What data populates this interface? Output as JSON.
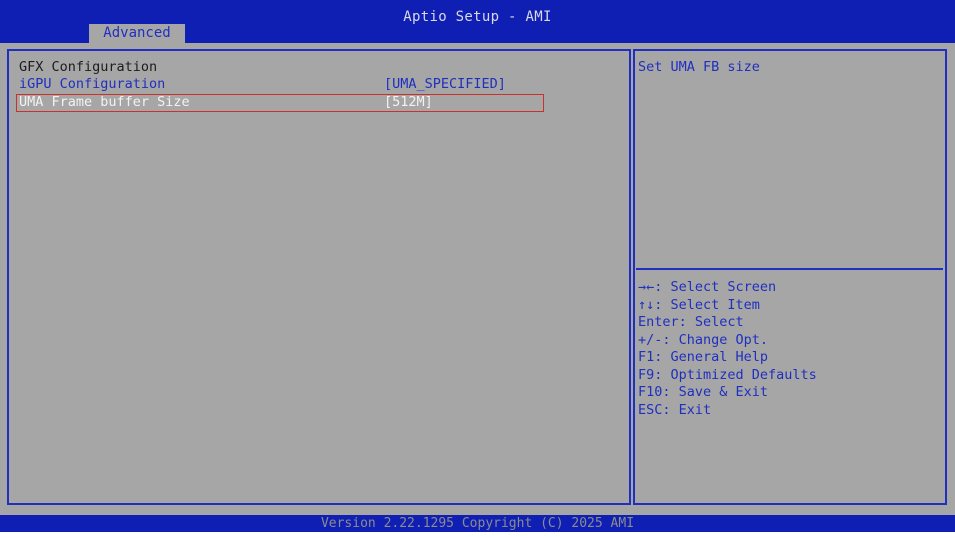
{
  "header": {
    "title": "Aptio Setup - AMI",
    "active_tab": "Advanced"
  },
  "main": {
    "section_title": "GFX Configuration",
    "items": [
      {
        "label": "iGPU Configuration",
        "value": "[UMA_SPECIFIED]"
      },
      {
        "label": "UMA Frame buffer Size",
        "value": "[512M]",
        "selected": true
      }
    ]
  },
  "help": {
    "description": "Set UMA FB size",
    "keys": [
      "→←: Select Screen",
      "↑↓: Select Item",
      "Enter: Select",
      "+/-: Change Opt.",
      "F1: General Help",
      "F9: Optimized Defaults",
      "F10: Save & Exit",
      "ESC: Exit"
    ]
  },
  "footer": {
    "version": "Version 2.22.1295 Copyright (C) 2025 AMI"
  },
  "colors": {
    "header_bg": "#0f1fb4",
    "panel_bg": "#a6a6a6",
    "text_blue": "#1f2fc0",
    "selection_border": "#c8322a"
  }
}
